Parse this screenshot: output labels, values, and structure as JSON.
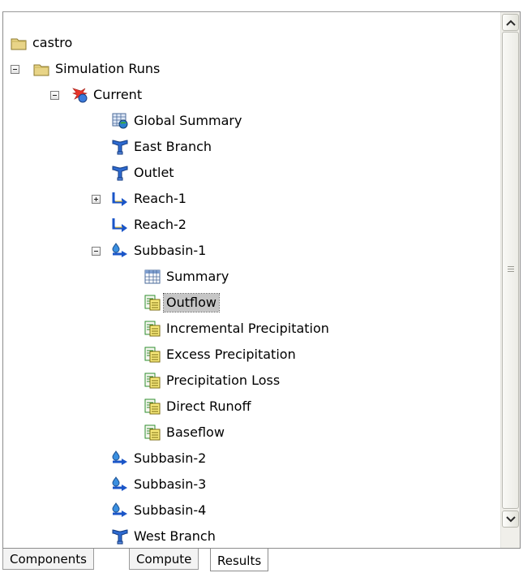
{
  "tree": {
    "root": {
      "label": "castro",
      "icon": "folder-icon"
    },
    "simulation_runs": {
      "label": "Simulation Runs",
      "icon": "folder-icon",
      "expanded": true
    },
    "current": {
      "label": "Current",
      "icon": "run-burst-icon",
      "expanded": true
    },
    "items": [
      {
        "label": "Global Summary",
        "icon": "global-summary-table-icon"
      },
      {
        "label": "East Branch",
        "icon": "junction-icon"
      },
      {
        "label": "Outlet",
        "icon": "junction-icon"
      },
      {
        "label": "Reach-1",
        "icon": "reach-icon",
        "expandable": true,
        "expanded": false
      },
      {
        "label": "Reach-2",
        "icon": "reach-icon"
      },
      {
        "label": "Subbasin-1",
        "icon": "subbasin-icon",
        "expandable": true,
        "expanded": true
      },
      {
        "label": "Summary",
        "icon": "summary-table-icon"
      },
      {
        "label": "Outflow",
        "icon": "timeseries-graph-icon",
        "selected": true
      },
      {
        "label": "Incremental Precipitation",
        "icon": "timeseries-graph-icon"
      },
      {
        "label": "Excess Precipitation",
        "icon": "timeseries-graph-icon"
      },
      {
        "label": "Precipitation Loss",
        "icon": "timeseries-graph-icon"
      },
      {
        "label": "Direct Runoff",
        "icon": "timeseries-graph-icon"
      },
      {
        "label": "Baseflow",
        "icon": "timeseries-graph-icon"
      },
      {
        "label": "Subbasin-2",
        "icon": "subbasin-icon"
      },
      {
        "label": "Subbasin-3",
        "icon": "subbasin-icon"
      },
      {
        "label": "Subbasin-4",
        "icon": "subbasin-icon"
      },
      {
        "label": "West Branch",
        "icon": "junction-icon"
      }
    ]
  },
  "tabs": [
    {
      "label": "Components",
      "active": false
    },
    {
      "label": "Compute",
      "active": false
    },
    {
      "label": "Results",
      "active": true
    }
  ],
  "colors": {
    "selection": "#c6c6c6",
    "folder": "#e8d487",
    "junction": "#2e6ad0",
    "reach": "#1a55c8",
    "graph_yellow": "#f7e97a",
    "graph_green": "#2e8f2e"
  }
}
